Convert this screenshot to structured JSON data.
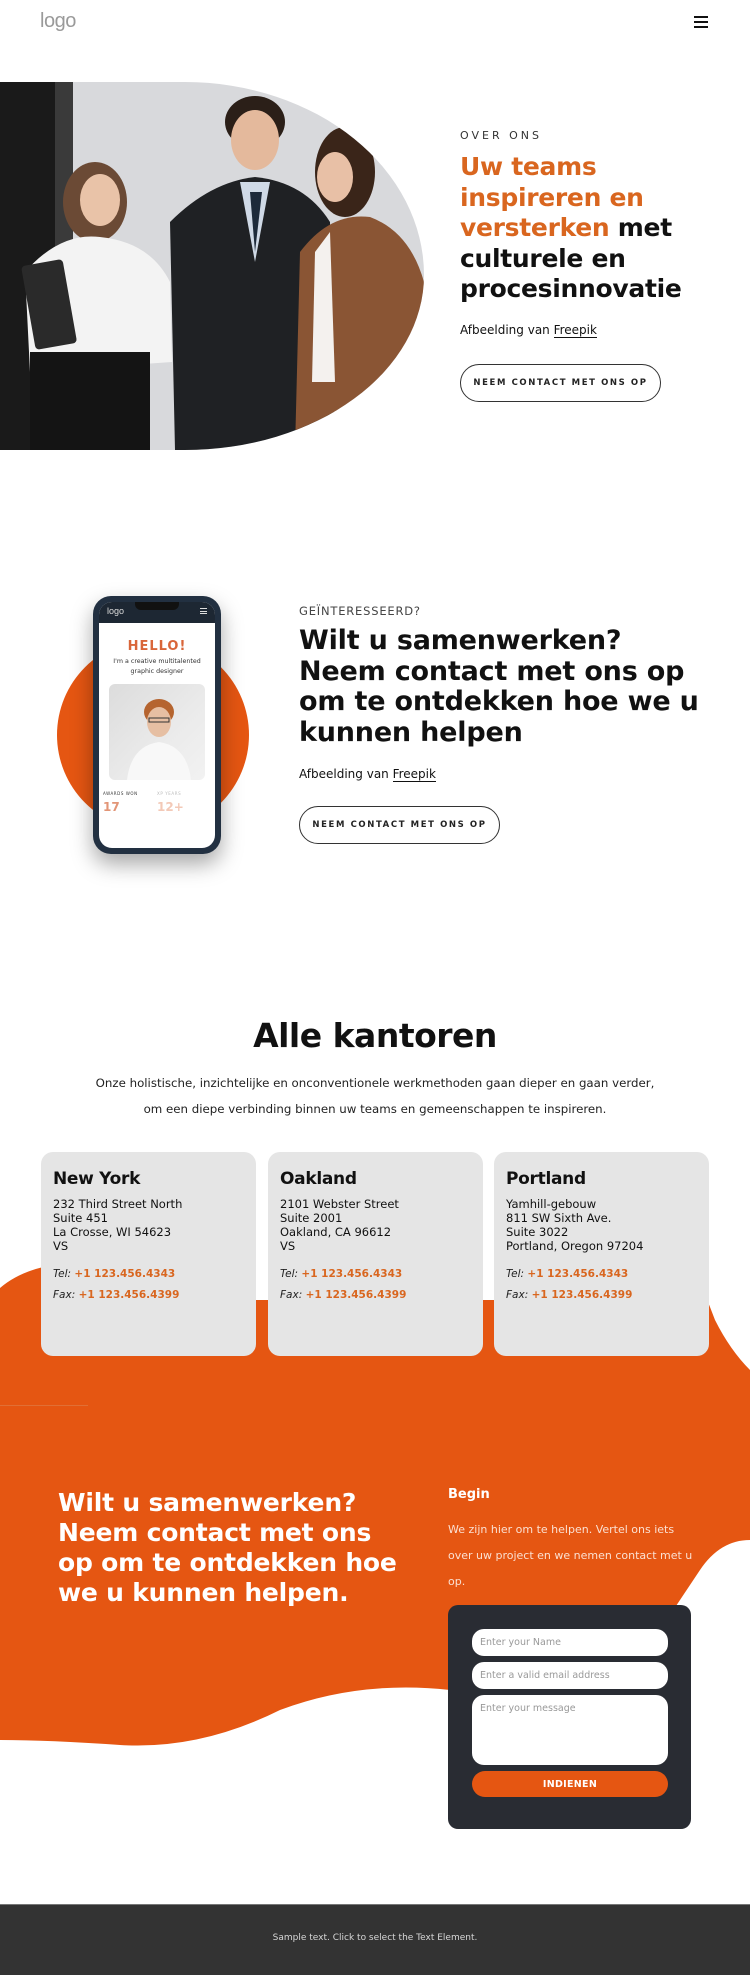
{
  "header": {
    "logo": "logo",
    "menu_icon": "hamburger-icon"
  },
  "about": {
    "kicker": "OVER ONS",
    "title_accent": "Uw teams inspireren en versterken",
    "title_rest": " met culturele en procesinnovatie",
    "credit_prefix": "Afbeelding van ",
    "credit_link": "Freepik",
    "button_label": "NEEM CONTACT MET ONS OP",
    "image_alt": "team-photo"
  },
  "collab": {
    "kicker": "GEÏNTERESSEERD?",
    "title": "Wilt u samenwerken? Neem contact met ons op om te ontdekken hoe we u kunnen helpen",
    "credit_prefix": "Afbeelding van ",
    "credit_link": "Freepik",
    "button_label": "NEEM CONTACT MET ONS OP",
    "phone_mockup": {
      "logo": "logo",
      "hello": "HELLO!",
      "subtitle": "I'm a creative multitalented graphic designer",
      "stat1_label": "AWARDS WON",
      "stat1_value": "17",
      "stat2_label": "XP YEARS",
      "stat2_value": "12+"
    }
  },
  "offices": {
    "title": "Alle kantoren",
    "description": "Onze holistische, inzichtelijke en onconventionele werkmethoden gaan dieper en gaan verder, om een diepe verbinding binnen uw teams en gemeenschappen te inspireren.",
    "tel_label": "Tel:",
    "fax_label": "Fax:",
    "items": [
      {
        "city": "New York",
        "address": [
          "232 Third Street North",
          "Suite 451",
          "La Crosse, WI 54623",
          "VS"
        ],
        "tel": "+1 123.456.4343",
        "fax": "+1 123.456.4399"
      },
      {
        "city": "Oakland",
        "address": [
          "2101 Webster Street",
          "Suite 2001",
          "Oakland, CA 96612",
          "VS"
        ],
        "tel": "+1 123.456.4343",
        "fax": "+1 123.456.4399"
      },
      {
        "city": "Portland",
        "address": [
          "Yamhill-gebouw",
          "811 SW Sixth Ave.",
          "Suite 3022",
          "Portland, Oregon 97204"
        ],
        "tel": "+1 123.456.4343",
        "fax": "+1 123.456.4399"
      }
    ]
  },
  "contact": {
    "title": "Wilt u samenwerken? Neem contact met ons op om te ontdekken hoe we u kunnen helpen.",
    "begin_heading": "Begin",
    "begin_text": "We zijn hier om te helpen. Vertel ons iets over uw project en we nemen contact met u op.",
    "form": {
      "name_placeholder": "Enter your Name",
      "email_placeholder": "Enter a valid email address",
      "message_placeholder": "Enter your message",
      "submit_label": "INDIENEN"
    }
  },
  "footer": {
    "text": "Sample text. Click to select the Text Element."
  },
  "colors": {
    "accent": "#e55612",
    "accent_text": "#d9661f",
    "card_bg": "#e5e5e5",
    "form_bg": "#292c33",
    "footer_bg": "#333333"
  }
}
